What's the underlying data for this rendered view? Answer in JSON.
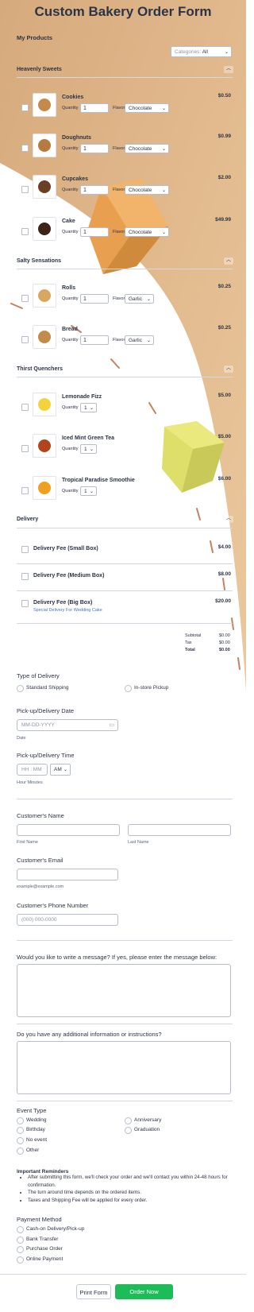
{
  "form": {
    "title": "Custom Bakery Order Form"
  },
  "products": {
    "heading": "My Products",
    "category_label": "Categories:",
    "category_value": "All"
  },
  "sections": {
    "heavenly": "Heavenly Sweets",
    "salty": "Salty Sensations",
    "thirst": "Thirst Quenchers",
    "delivery": "Delivery"
  },
  "common": {
    "quantity": "Quantity",
    "flavor": "Flavor"
  },
  "heavenly_items": [
    {
      "name": "Cookies",
      "price": "$0.50",
      "qty": "1",
      "flavor": "Chocolate"
    },
    {
      "name": "Doughnuts",
      "price": "$0.99",
      "qty": "1",
      "flavor": "Chocolate"
    },
    {
      "name": "Cupcakes",
      "price": "$2.00",
      "qty": "1",
      "flavor": "Chocolate"
    },
    {
      "name": "Cake",
      "price": "$49.99",
      "qty": "1",
      "flavor": "Chocolate"
    }
  ],
  "salty_items": [
    {
      "name": "Rolls",
      "price": "$0.25",
      "qty": "1",
      "flavor": "Garlic"
    },
    {
      "name": "Bread",
      "price": "$0.25",
      "qty": "1",
      "flavor": "Garlic"
    }
  ],
  "thirst_items": [
    {
      "name": "Lemonade Fizz",
      "price": "$5.00",
      "qty": "1"
    },
    {
      "name": "Iced Mint Green Tea",
      "price": "$5.00",
      "qty": "1"
    },
    {
      "name": "Tropical Paradise Smoothie",
      "price": "$6.00",
      "qty": "1"
    }
  ],
  "delivery_items": [
    {
      "name": "Delivery Fee (Small Box)",
      "price": "$4.00",
      "sub": ""
    },
    {
      "name": "Delivery Fee (Medium Box)",
      "price": "$8.00",
      "sub": ""
    },
    {
      "name": "Delivery Fee (Big Box)",
      "price": "$20.00",
      "sub": "Special Delivery For Wedding Cake"
    }
  ],
  "totals": {
    "subtotal_label": "Subtotal",
    "subtotal": "$0.00",
    "tax_label": "Tax",
    "tax": "$0.00",
    "total_label": "Total",
    "total": "$0.00"
  },
  "delivery_type": {
    "label": "Type of Delivery",
    "options": [
      "Standard Shipping",
      "In-store Pickup"
    ]
  },
  "date": {
    "label": "Pick-up/Delivery Date",
    "placeholder": "MM-DD-YYYY",
    "sub": "Date"
  },
  "time": {
    "label": "Pick-up/Delivery Time",
    "placeholder": "HH : MM",
    "ampm": "AM",
    "sub": "Hour Minutes"
  },
  "name": {
    "label": "Customer's Name",
    "first": "First Name",
    "last": "Last Name"
  },
  "email": {
    "label": "Customer's Email",
    "sub": "example@example.com"
  },
  "phone": {
    "label": "Customer's Phone Number",
    "placeholder": "(000) 000-0000"
  },
  "message": {
    "label": "Would you like to write a message? If yes, please enter the message below:"
  },
  "additional": {
    "label": "Do you have any additional information or instructions?"
  },
  "event": {
    "label": "Event Type",
    "options": [
      "Wedding",
      "Anniversary",
      "Birthday",
      "Graduation",
      "No event",
      "Other"
    ]
  },
  "reminders": {
    "title": "Important Reminders",
    "items": [
      "After submitting this form, we'll check your order and we'll contact you within 24-48 hours for confirmation.",
      "The turn around time depends on the ordered items.",
      "Taxes and Shipping Fee will be applied for every order."
    ]
  },
  "payment": {
    "label": "Payment Method",
    "options": [
      "Cash-on Delivery/Pick-up",
      "Bank Transfer",
      "Purchase Order",
      "Online Payment"
    ]
  },
  "buttons": {
    "print": "Print Form",
    "order": "Order Now"
  },
  "colors": {
    "accent_bg": "#e8be90",
    "cube_orange": "#e8a050",
    "cube_yellow": "#dede6a",
    "button_green": "#1ebc58",
    "text": "#2c3345"
  }
}
